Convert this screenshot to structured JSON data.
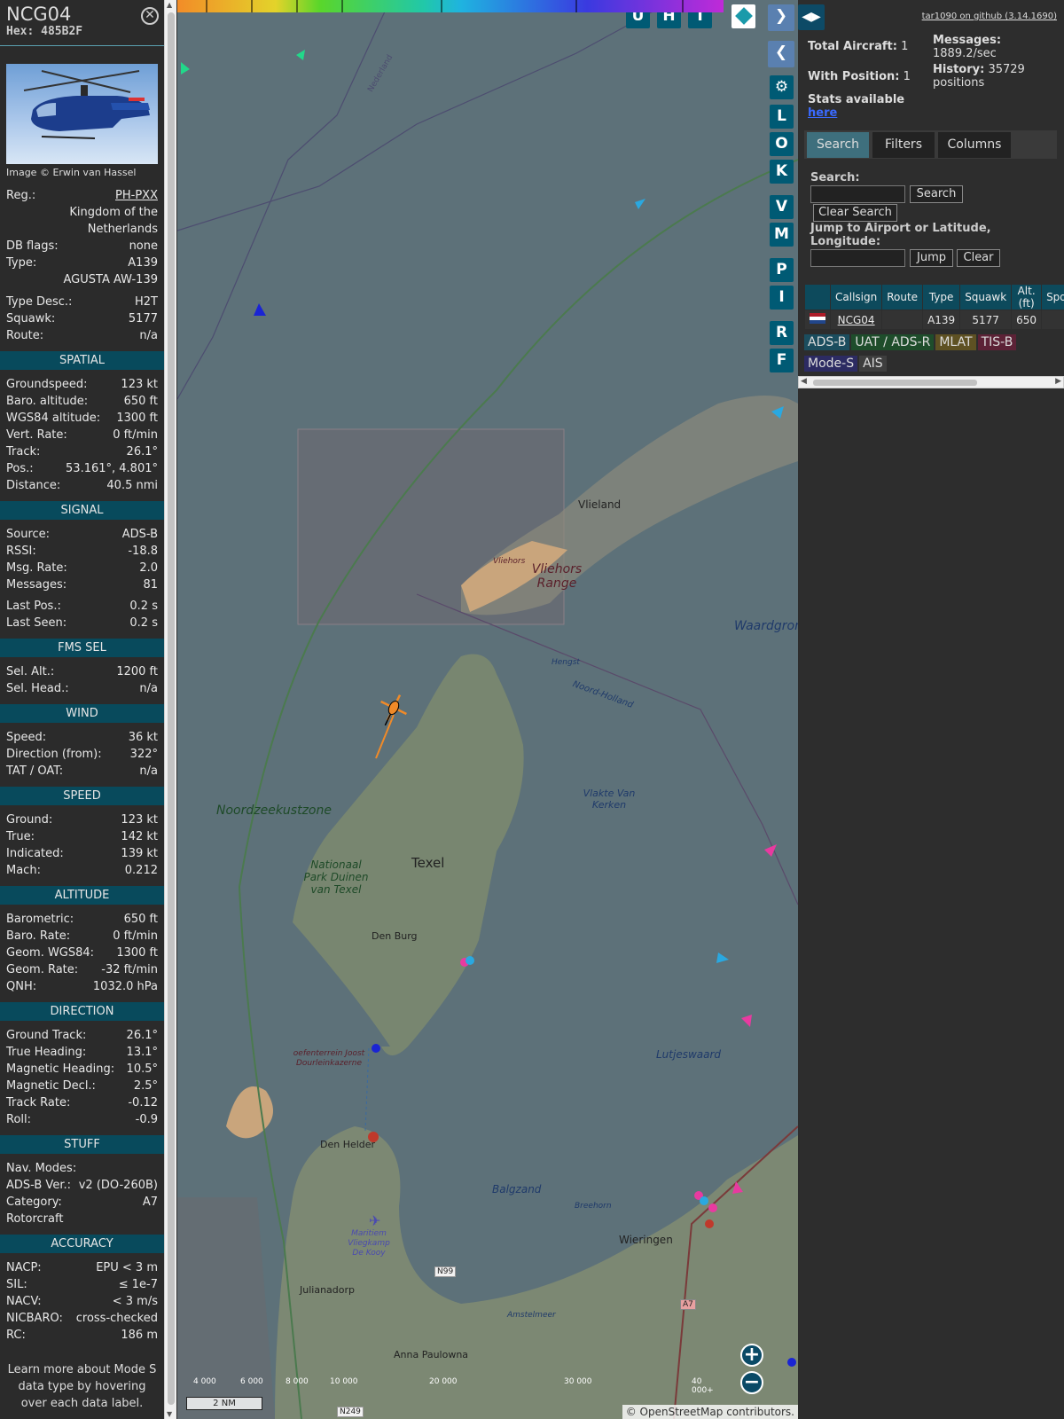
{
  "sidebar": {
    "callsign": "NCG04",
    "hex_label": "Hex: 485B2F",
    "photo_credit": "Image © Erwin van Hassel",
    "info": [
      {
        "label": "Reg.:",
        "value": "PH-PXX",
        "link": true
      },
      {
        "label": "",
        "value": "Kingdom of the Netherlands"
      },
      {
        "label": "DB flags:",
        "value": "none"
      },
      {
        "label": "Type:",
        "value": "A139"
      },
      {
        "label": "",
        "value": "AGUSTA AW-139"
      },
      {
        "label": "Type Desc.:",
        "value": "H2T"
      },
      {
        "label": "Squawk:",
        "value": "5177"
      },
      {
        "label": "Route:",
        "value": "n/a"
      }
    ],
    "sections": [
      {
        "title": "SPATIAL",
        "rows": [
          {
            "label": "Groundspeed:",
            "value": "123 kt"
          },
          {
            "label": "Baro. altitude:",
            "value": "650 ft"
          },
          {
            "label": "WGS84 altitude:",
            "value": "1300 ft"
          },
          {
            "label": "Vert. Rate:",
            "value": "0 ft/min"
          },
          {
            "label": "Track:",
            "value": "26.1°"
          },
          {
            "label": "Pos.:",
            "value": "53.161°, 4.801°"
          },
          {
            "label": "Distance:",
            "value": "40.5 nmi"
          }
        ]
      },
      {
        "title": "SIGNAL",
        "rows": [
          {
            "label": "Source:",
            "value": "ADS-B"
          },
          {
            "label": "RSSI:",
            "value": "-18.8"
          },
          {
            "label": "Msg. Rate:",
            "value": "2.0"
          },
          {
            "label": "Messages:",
            "value": "81"
          },
          {
            "label": "Last Pos.:",
            "value": "0.2 s",
            "gap": true
          },
          {
            "label": "Last Seen:",
            "value": "0.2 s"
          }
        ]
      },
      {
        "title": "FMS SEL",
        "rows": [
          {
            "label": "Sel. Alt.:",
            "value": "1200 ft"
          },
          {
            "label": "Sel. Head.:",
            "value": "n/a"
          }
        ]
      },
      {
        "title": "WIND",
        "rows": [
          {
            "label": "Speed:",
            "value": "36 kt"
          },
          {
            "label": "Direction (from):",
            "value": "322°"
          },
          {
            "label": "TAT / OAT:",
            "value": "n/a"
          }
        ]
      },
      {
        "title": "SPEED",
        "rows": [
          {
            "label": "Ground:",
            "value": "123 kt"
          },
          {
            "label": "True:",
            "value": "142 kt"
          },
          {
            "label": "Indicated:",
            "value": "139 kt"
          },
          {
            "label": "Mach:",
            "value": "0.212"
          }
        ]
      },
      {
        "title": "ALTITUDE",
        "rows": [
          {
            "label": "Barometric:",
            "value": "650 ft"
          },
          {
            "label": "Baro. Rate:",
            "value": "0 ft/min"
          },
          {
            "label": "Geom. WGS84:",
            "value": "1300 ft"
          },
          {
            "label": "Geom. Rate:",
            "value": "-32 ft/min"
          },
          {
            "label": "QNH:",
            "value": "1032.0 hPa"
          }
        ]
      },
      {
        "title": "DIRECTION",
        "rows": [
          {
            "label": "Ground Track:",
            "value": "26.1°"
          },
          {
            "label": "True Heading:",
            "value": "13.1°"
          },
          {
            "label": "Magnetic Heading:",
            "value": "10.5°"
          },
          {
            "label": "Magnetic Decl.:",
            "value": "2.5°"
          },
          {
            "label": "Track Rate:",
            "value": "-0.12"
          },
          {
            "label": "Roll:",
            "value": "-0.9"
          }
        ]
      },
      {
        "title": "STUFF",
        "rows": [
          {
            "label": "Nav. Modes:",
            "value": ""
          },
          {
            "label": "ADS-B Ver.:",
            "value": "v2 (DO-260B)"
          },
          {
            "label": "Category:",
            "value": "A7"
          },
          {
            "label": "Rotorcraft",
            "value": ""
          }
        ]
      },
      {
        "title": "ACCURACY",
        "rows": [
          {
            "label": "NACP:",
            "value": "EPU < 3 m"
          },
          {
            "label": "SIL:",
            "value": "≤ 1e-7"
          },
          {
            "label": "NACV:",
            "value": "< 3 m/s"
          },
          {
            "label": "NICBARO:",
            "value": "cross-checked"
          },
          {
            "label": "RC:",
            "value": "186 m"
          }
        ]
      }
    ],
    "footnote": "Learn more about Mode S data type by hovering over each data label."
  },
  "map": {
    "top_buttons": [
      "U",
      "H",
      "T"
    ],
    "side_buttons": [
      "L",
      "O",
      "K",
      "V",
      "M",
      "P",
      "I",
      "R",
      "F"
    ],
    "place_labels": [
      "Vlieland",
      "Vliehors Range",
      "Waardgronden",
      "Noordzeekustzone",
      "Texel",
      "Nationaal Park Duinen van Texel",
      "Den Burg",
      "Vlakte Van Kerken",
      "Lutjeswaard",
      "Den Helder",
      "Balgzand",
      "Wieringen",
      "Julianadorp",
      "Anna Paulowna",
      "Maritiem Vliegkamp De Kooy",
      "Amstelmeer",
      "oefenterrein Joost Dourleinkazerne",
      "N99",
      "A7",
      "N249",
      "Breehorn",
      "Hengst",
      "Noord-Holland",
      "Vliehors",
      "Nederland"
    ],
    "altitude_legend": [
      "4 000",
      "6 000",
      "8 000",
      "10 000",
      "20 000",
      "30 000",
      "40 000+"
    ],
    "scale_label": "2 NM",
    "attribution_prefix": "©",
    "attribution_link": "OpenStreetMap",
    "attribution_suffix": "contributors."
  },
  "right": {
    "github_link": "tar1090 on github (3.14.1690)",
    "total_aircraft_label": "Total Aircraft:",
    "total_aircraft": "1",
    "with_position_label": "With Position:",
    "with_position": "1",
    "messages_label": "Messages:",
    "messages_rate": "1889.2/sec",
    "history_label": "History:",
    "history_value": "35729 positions",
    "stats_label": "Stats available",
    "stats_link": "here",
    "tabs": [
      "Search",
      "Filters",
      "Columns"
    ],
    "search_label": "Search:",
    "search_button": "Search",
    "clear_search_button": "Clear Search",
    "jump_label": "Jump to Airport or Latitude, Longitude:",
    "jump_button": "Jump",
    "clear_button": "Clear",
    "table_headers": [
      "",
      "Callsign",
      "Route",
      "Type",
      "Squawk",
      "Alt. (ft)",
      "Spd."
    ],
    "table_rows": [
      {
        "callsign": "NCG04",
        "route": "",
        "type": "A139",
        "squawk": "5177",
        "alt": "650",
        "spd": ""
      }
    ],
    "source_chips": [
      {
        "label": "ADS-B",
        "color": "#1b4d5e"
      },
      {
        "label": "UAT / ADS-R",
        "color": "#1e4d2b"
      },
      {
        "label": "MLAT",
        "color": "#5e5123"
      },
      {
        "label": "TIS-B",
        "color": "#5c2236"
      },
      {
        "label": "Mode-S",
        "color": "#2c2b62"
      },
      {
        "label": "AIS",
        "color": "#3e3e3e"
      }
    ]
  }
}
